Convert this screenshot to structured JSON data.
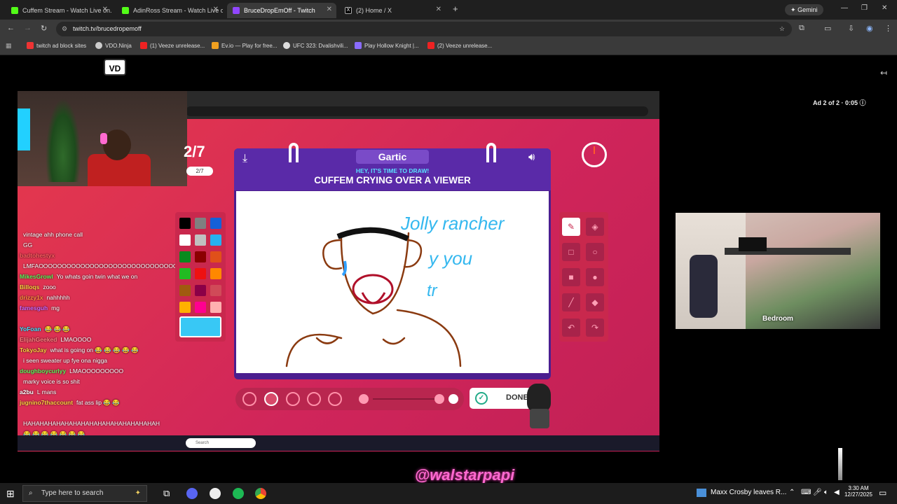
{
  "tabs": [
    {
      "label": "Cuffem Stream - Watch Live on...",
      "icon_color": "#53fc18"
    },
    {
      "label": "AdinRoss Stream - Watch Live o...",
      "icon_color": "#53fc18"
    },
    {
      "label": "BruceDropEmOff - Twitch",
      "icon_color": "#9146ff"
    },
    {
      "label": "(2) Home / X",
      "icon_color": "#ffffff"
    }
  ],
  "gemini_label": "Gemini",
  "url": "twitch.tv/brucedropemoff",
  "bookmarks": [
    "twitch ad block sites",
    "VDO.Ninja",
    "(1) Veeze unrelease...",
    "Ev.io — Play for free...",
    "UFC 323: Dvalishvili...",
    "Play Hollow Knight |...",
    "(2) Veeze unrelease..."
  ],
  "ad_text": "Ad 2 of 2 · 0:05",
  "vd_logo": "VD",
  "round": {
    "big": "2/7",
    "small": "2/7"
  },
  "game": {
    "logo": "Gartic",
    "subtitle": "HEY, IT'S TIME TO DRAW!",
    "prompt": "CUFFEM CRYING OVER A VIEWER",
    "done": "DONE"
  },
  "drawing_text": [
    "Jolly rancher",
    "y you",
    "tr"
  ],
  "palette": [
    "#000000",
    "#808080",
    "#1560d8",
    "#ffffff",
    "#c0c0c0",
    "#27b0f0",
    "#0a8a1e",
    "#8b0000",
    "#e0501a",
    "#22bb22",
    "#ee1111",
    "#ff8800",
    "#a05a10",
    "#8b0047",
    "#d04a58",
    "#ffb000",
    "#ff0090",
    "#ffb0b0"
  ],
  "selected_color": "#38c8f5",
  "chat": [
    {
      "user": "",
      "msg": "vintage ahh phone call",
      "color": "#aaaaaa"
    },
    {
      "user": "",
      "msg": "GG",
      "color": "#8888ff"
    },
    {
      "user": "badtohestyx",
      "msg": "",
      "color": "#ff6060"
    },
    {
      "user": "",
      "msg": "LMFAOOOOOOOOOOOOOOOOOOOOOOOOOOOOOOOOO",
      "color": "#ffffff"
    },
    {
      "user": "MikesGrowl",
      "msg": "Yo whats goin twin what we on",
      "color": "#5cf55c"
    },
    {
      "user": "Billoqs",
      "msg": "zooo",
      "color": "#ffd040"
    },
    {
      "user": "drizzy1x",
      "msg": "nahhhhh",
      "color": "#ff8c40"
    },
    {
      "user": "famesguh",
      "msg": "mg",
      "color": "#cc66ff"
    },
    {
      "user": "",
      "msg": "",
      "color": "#ff5050"
    },
    {
      "user": "YoFoan",
      "msg": "😂 😂 😂",
      "color": "#40e0ff"
    },
    {
      "user": "ElijahGeeked",
      "msg": "LMAOOOO",
      "color": "#ff8080"
    },
    {
      "user": "TokyoJay",
      "msg": "what is going on 😂 😂 😂 😂 😂",
      "color": "#ffd040"
    },
    {
      "user": "",
      "msg": "i seen sweater up fye ona nigga",
      "color": "#8888ff"
    },
    {
      "user": "doughboycurlyy",
      "msg": "LMAOOOOOOOOO",
      "color": "#5cf55c"
    },
    {
      "user": "",
      "msg": "marky voice is so shit",
      "color": "#ff8080"
    },
    {
      "user": "a2bu",
      "msg": "L mans",
      "color": "#ffffff"
    },
    {
      "user": "jugnino7thaccount",
      "msg": "fat ass lip 😂 😂",
      "color": "#ffd040"
    },
    {
      "user": "",
      "msg": "",
      "color": "#5cf55c"
    },
    {
      "user": "",
      "msg": "HAHAHAHAHAHAHAHAHAHAHAHAHAHAHAHAH",
      "color": "#ffffff"
    },
    {
      "user": "",
      "msg": "😂 😂 😂 😂 😂 😂 😂",
      "color": "#8888ff"
    }
  ],
  "room_label": "Bedroom",
  "watermark": "@walstarpapi",
  "taskbar": {
    "search_placeholder": "Type here to search",
    "news": "Maxx Crosby leaves R...",
    "time": "3:30 AM",
    "date": "12/27/2025"
  },
  "inner_taskbar_search": "Search"
}
